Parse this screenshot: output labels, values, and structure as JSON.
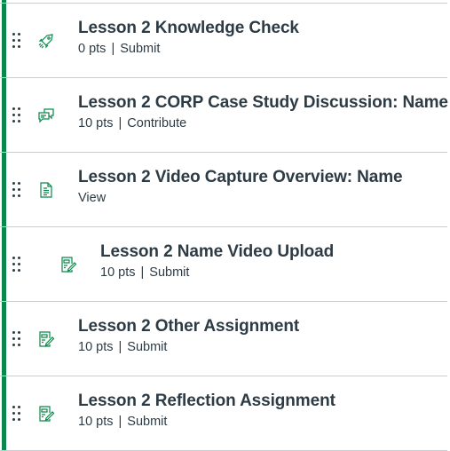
{
  "accent_color": "#0b874b",
  "items": [
    {
      "title": "Lesson 2 Knowledge Check",
      "points": "0 pts",
      "action": "Submit",
      "icon": "quiz-rocket-icon",
      "indent": 0
    },
    {
      "title": "Lesson 2 CORP Case Study Discussion: Name",
      "points": "10 pts",
      "action": "Contribute",
      "icon": "discussion-icon",
      "indent": 0
    },
    {
      "title": "Lesson 2 Video Capture Overview: Name",
      "points": null,
      "action": "View",
      "icon": "page-document-icon",
      "indent": 0
    },
    {
      "title": "Lesson 2 Name Video Upload",
      "points": "10 pts",
      "action": "Submit",
      "icon": "assignment-icon",
      "indent": 1
    },
    {
      "title": "Lesson 2 Other Assignment",
      "points": "10 pts",
      "action": "Submit",
      "icon": "assignment-icon",
      "indent": 0
    },
    {
      "title": "Lesson 2 Reflection Assignment",
      "points": "10 pts",
      "action": "Submit",
      "icon": "assignment-icon",
      "indent": 0
    }
  ],
  "separator": "|"
}
